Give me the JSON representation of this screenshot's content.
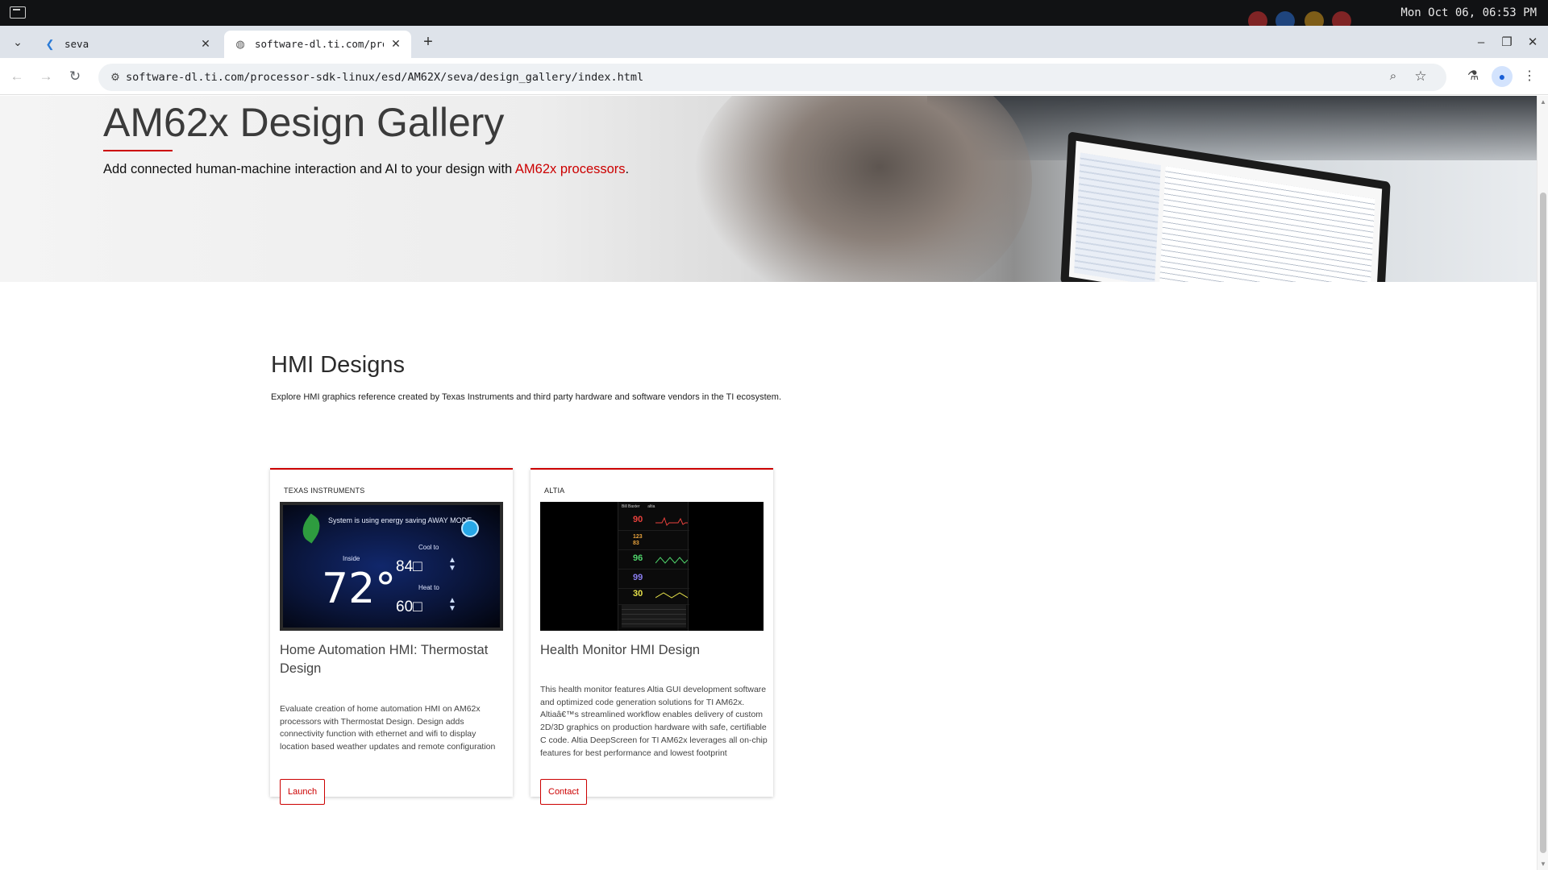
{
  "os": {
    "clock": "Mon Oct 06, 06:53 PM"
  },
  "browser": {
    "tabs": [
      {
        "title": "seva",
        "active": false
      },
      {
        "title": "software-dl.ti.com/proce",
        "active": true
      }
    ],
    "url": "software-dl.ti.com/processor-sdk-linux/esd/AM62X/seva/design_gallery/index.html"
  },
  "hero": {
    "title": "AM62x Design Gallery",
    "subtitle_prefix": "Add connected human-machine interaction and AI to your design with ",
    "subtitle_link": "AM62x processors",
    "subtitle_suffix": "."
  },
  "section": {
    "title": "HMI Designs",
    "description": "Explore HMI graphics reference created by Texas Instruments and third party hardware and software vendors in the TI ecosystem."
  },
  "cards": [
    {
      "vendor": "TEXAS INSTRUMENTS",
      "title": "Home Automation HMI: Thermostat Design",
      "description": "Evaluate creation of home automation HMI on AM62x processors with Thermostat Design. Design adds connectivity function with ethernet and wifi to display location based weather updates and remote configuration",
      "button": "Launch",
      "thumb": {
        "message": "System is using energy saving AWAY MODE",
        "inside_label": "Inside",
        "inside_temp": "72°",
        "cool_label": "Cool to",
        "cool_value": "84□",
        "heat_label": "Heat to",
        "heat_value": "60□"
      }
    },
    {
      "vendor": "ALTIA",
      "title": "Health Monitor HMI Design",
      "description": "This health monitor features Altia GUI development software and optimized code generation solutions for TI AM62x. Altiaâ€™s streamlined workflow enables delivery of custom 2D/3D graphics on production hardware with safe, certifiable C code. Altia DeepScreen for TI AM62x leverages all on-chip features for best performance and lowest footprint",
      "button": "Contact",
      "thumb": {
        "header_left": "Bill Baxter",
        "header_right": "altia",
        "vitals": [
          {
            "value": "90",
            "color": "#e8413c"
          },
          {
            "value": "123\n83",
            "color": "#e8a23c"
          },
          {
            "value": "96",
            "color": "#4fd36b"
          },
          {
            "value": "99",
            "color": "#8a7df0"
          },
          {
            "value": "30",
            "color": "#e5e04a"
          }
        ]
      }
    }
  ],
  "colors": {
    "ti_red": "#cc0000",
    "text_dark": "#2b2b2b"
  }
}
